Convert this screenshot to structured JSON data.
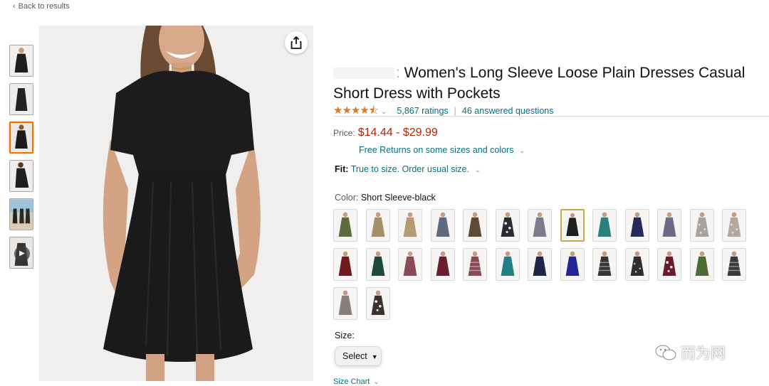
{
  "nav": {
    "back_label": "Back to results"
  },
  "product": {
    "title": "Women's Long Sleeve Loose Plain Dresses Casual Short Dress with Pockets",
    "rating_stars": 4.5,
    "ratings_count": "5,867 ratings",
    "answered_questions": "46 answered questions",
    "price_label": "Price:",
    "price": "$14.44 - $29.99",
    "returns": "Free Returns on some sizes and colors",
    "fit_label": "Fit:",
    "fit_value": "True to size. Order usual size.",
    "color_label": "Color:",
    "color_value": "Short Sleeve-black",
    "size_label": "Size:",
    "size_select": "Select",
    "size_chart": "Size Chart"
  },
  "gallery": {
    "thumbnails": [
      {
        "name": "thumb-1",
        "icon": "dress-photo",
        "selected": false
      },
      {
        "name": "thumb-2",
        "icon": "dress-photo",
        "selected": false
      },
      {
        "name": "thumb-3",
        "icon": "dress-photo",
        "selected": true
      },
      {
        "name": "thumb-4",
        "icon": "dress-photo",
        "selected": false
      },
      {
        "name": "thumb-5",
        "icon": "beach-photo",
        "selected": false
      },
      {
        "name": "thumb-6",
        "icon": "video-play",
        "selected": false
      }
    ]
  },
  "swatches": [
    {
      "color": "#5e6b3a",
      "selected": false
    },
    {
      "color": "#a58e6a",
      "selected": false
    },
    {
      "color": "#b79a73",
      "selected": false
    },
    {
      "color": "#5f6a80",
      "selected": false
    },
    {
      "color": "#5e4a36",
      "selected": false
    },
    {
      "color": "#2b2b30",
      "pattern": "floral",
      "selected": false
    },
    {
      "color": "#7d7a8e",
      "selected": false
    },
    {
      "color": "#1f1f1f",
      "selected": true
    },
    {
      "color": "#2c7f7d",
      "selected": false
    },
    {
      "color": "#252a5a",
      "selected": false
    },
    {
      "color": "#6e6a86",
      "selected": false
    },
    {
      "color": "#a8a39f",
      "pattern": "print",
      "selected": false
    },
    {
      "color": "#b5a8a0",
      "pattern": "print",
      "selected": false
    },
    {
      "color": "#6e1a1e",
      "selected": false
    },
    {
      "color": "#1e4a3a",
      "selected": false
    },
    {
      "color": "#8a4a5a",
      "selected": false
    },
    {
      "color": "#6a1e30",
      "selected": false
    },
    {
      "color": "#8a4a55",
      "pattern": "stripe",
      "selected": false
    },
    {
      "color": "#217f86",
      "selected": false
    },
    {
      "color": "#1e2548",
      "selected": false
    },
    {
      "color": "#23269a",
      "selected": false
    },
    {
      "color": "#353535",
      "pattern": "stripe",
      "selected": false
    },
    {
      "color": "#2e2e2e",
      "pattern": "print",
      "selected": false
    },
    {
      "color": "#6a1a2a",
      "pattern": "floral",
      "selected": false
    },
    {
      "color": "#4e6a36",
      "selected": false
    },
    {
      "color": "#3a3a3a",
      "pattern": "stripe",
      "selected": false
    },
    {
      "color": "#8a7e78",
      "selected": false
    },
    {
      "color": "#3a3030",
      "pattern": "floral",
      "selected": false
    }
  ],
  "colors": {
    "link": "#007185",
    "price": "#b12704",
    "star": "#de7921",
    "selected_thumb": "#e77600",
    "selected_swatch": "#c8a84c"
  },
  "watermark": {
    "text": "而为网",
    "icon": "wechat-icon"
  }
}
